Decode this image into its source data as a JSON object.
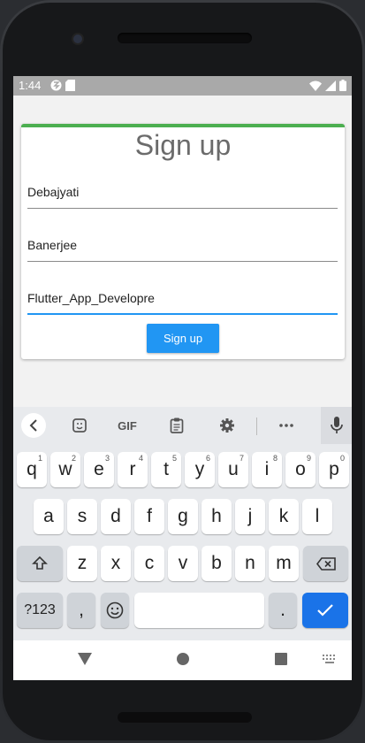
{
  "status_bar": {
    "time": "1:44"
  },
  "page": {
    "title": "Sign up",
    "fields": [
      {
        "value": "Debajyati"
      },
      {
        "value": "Banerjee"
      },
      {
        "value": "Flutter_App_Developre"
      }
    ],
    "submit_label": "Sign up"
  },
  "keyboard": {
    "toolbar": {
      "gif_label": "GIF"
    },
    "row1": [
      [
        "q",
        "1"
      ],
      [
        "w",
        "2"
      ],
      [
        "e",
        "3"
      ],
      [
        "r",
        "4"
      ],
      [
        "t",
        "5"
      ],
      [
        "y",
        "6"
      ],
      [
        "u",
        "7"
      ],
      [
        "i",
        "8"
      ],
      [
        "o",
        "9"
      ],
      [
        "p",
        "0"
      ]
    ],
    "row2": [
      "a",
      "s",
      "d",
      "f",
      "g",
      "h",
      "j",
      "k",
      "l"
    ],
    "row3": [
      "z",
      "x",
      "c",
      "v",
      "b",
      "n",
      "m"
    ],
    "symbols_label": "?123",
    "comma_label": ",",
    "period_label": ".",
    "accent_color": "#1a73e8"
  },
  "colors": {
    "primary": "#2196f3",
    "card_accent": "#4caf50",
    "status_bar": "#a9a9a9"
  }
}
